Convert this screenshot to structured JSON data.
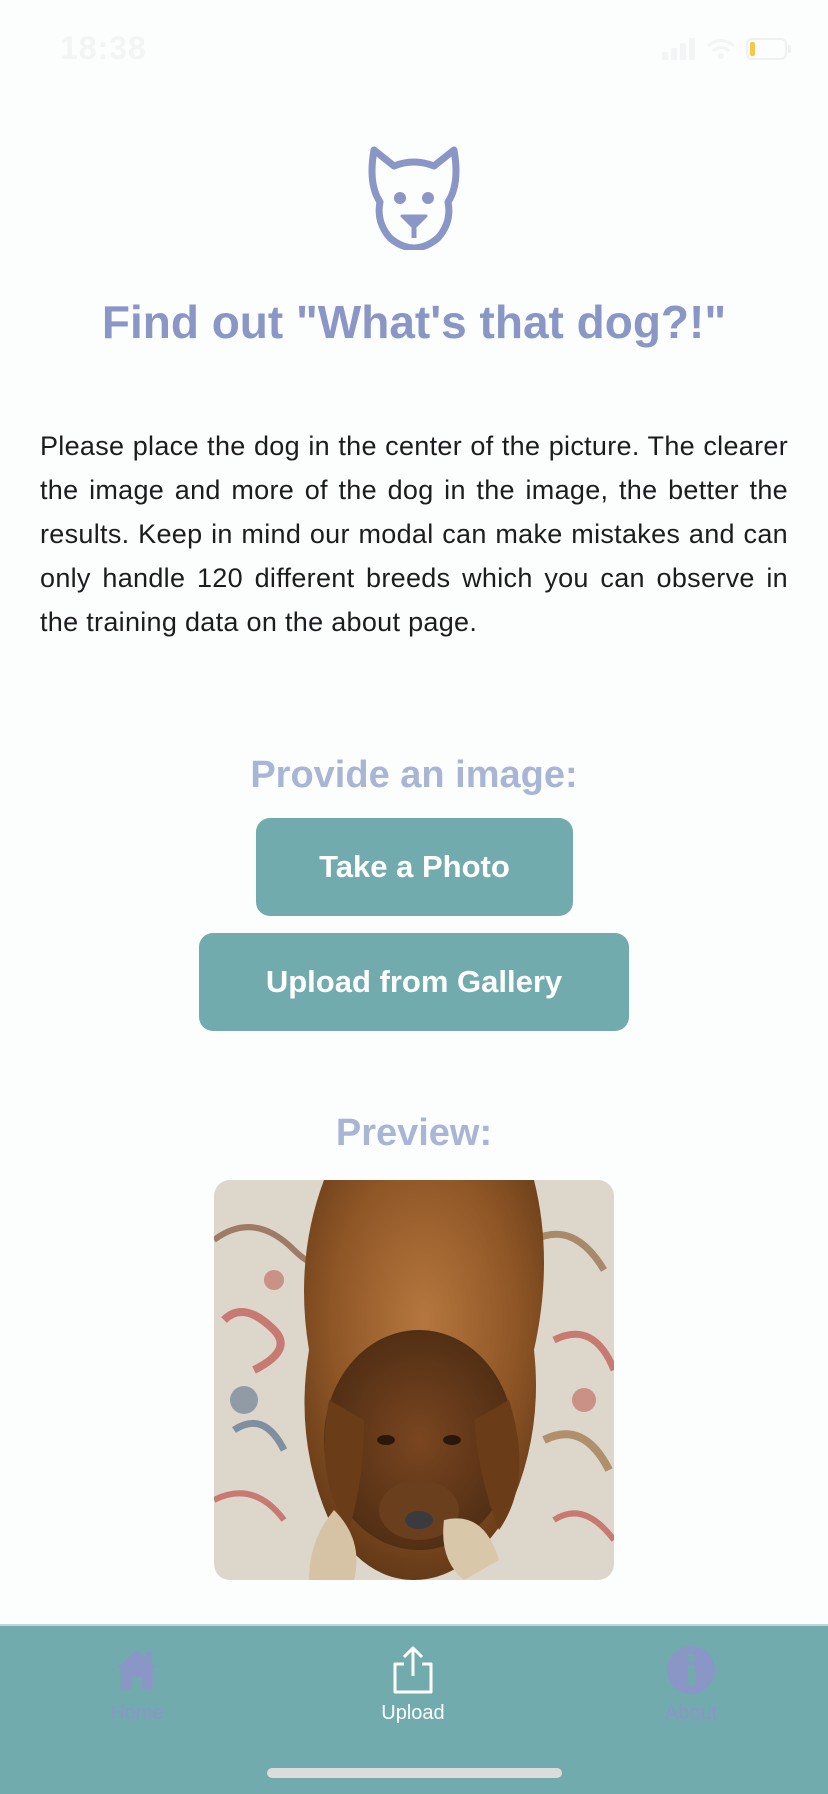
{
  "status_bar": {
    "time": "18:38"
  },
  "header": {
    "logo_icon": "dog-face-icon",
    "title": "Find out \"What's that dog?!\""
  },
  "instructions": "Please place the dog in the center of the picture. The clearer the image and more of the dog in the image, the better the results. Keep in mind our modal can make mistakes and can only handle 120 different breeds which you can observe in the training data on the about page.",
  "image_input": {
    "label": "Provide an image:",
    "take_photo_label": "Take a Photo",
    "upload_gallery_label": "Upload from Gallery"
  },
  "preview": {
    "label": "Preview:"
  },
  "tab_bar": {
    "tabs": [
      {
        "label": "Home",
        "icon": "home-icon",
        "active": false
      },
      {
        "label": "Upload",
        "icon": "upload-icon",
        "active": true
      },
      {
        "label": "About",
        "icon": "info-icon",
        "active": false
      }
    ]
  },
  "colors": {
    "accent": "#72abae",
    "title": "#8a96c5",
    "subtitle": "#a9b5d4",
    "battery": "#f5c84a"
  }
}
